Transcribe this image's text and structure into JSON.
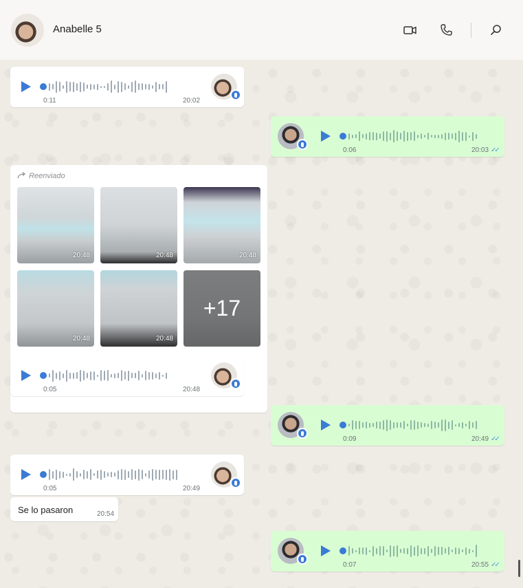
{
  "header": {
    "contact_name": "Anabelle 5",
    "icons": [
      "video-call-icon",
      "voice-call-icon",
      "search-icon"
    ]
  },
  "messages": [
    {
      "type": "voice",
      "direction": "in",
      "duration": "0:11",
      "time": "20:02"
    },
    {
      "type": "voice",
      "direction": "out",
      "duration": "0:06",
      "time": "20:03",
      "status": "read"
    },
    {
      "type": "gallery",
      "direction": "in",
      "forwarded_label": "Reenviado",
      "items": [
        {
          "time": "20:48"
        },
        {
          "time": "20:48"
        },
        {
          "time": "20:48"
        },
        {
          "time": "20:48"
        },
        {
          "time": "20:48"
        },
        {
          "more_label": "+17"
        }
      ]
    },
    {
      "type": "voice",
      "direction": "in",
      "duration": "0:05",
      "time": "20:48"
    },
    {
      "type": "voice",
      "direction": "out",
      "duration": "0:09",
      "time": "20:49",
      "status": "read"
    },
    {
      "type": "voice",
      "direction": "in",
      "duration": "0:05",
      "time": "20:49"
    },
    {
      "type": "text",
      "direction": "in",
      "text": "Se lo pasaron",
      "time": "20:54"
    },
    {
      "type": "voice",
      "direction": "out",
      "duration": "0:07",
      "time": "20:55",
      "status": "read"
    }
  ],
  "colors": {
    "accent": "#3a7bd5",
    "incoming_bubble": "#ffffff",
    "outgoing_bubble": "#d9fdd3",
    "read_ticks": "#4a9ad8"
  }
}
